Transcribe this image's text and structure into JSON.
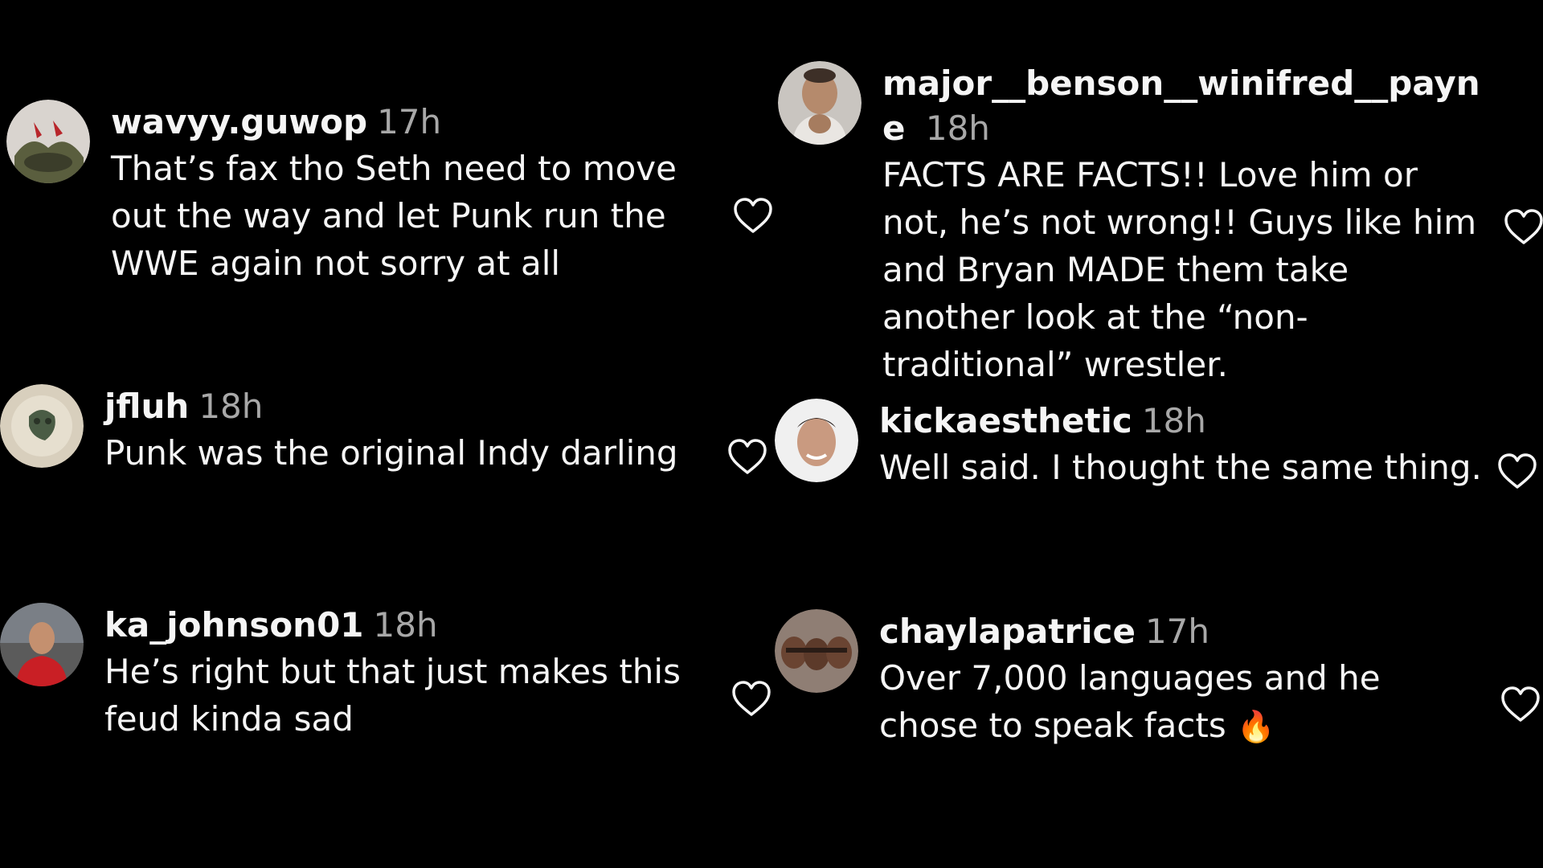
{
  "comments": [
    {
      "username": "wavyy.guwop",
      "time": "17h",
      "text": "That’s fax tho Seth need to move out the way and let Punk run the WWE again not sorry at all"
    },
    {
      "username": "major__benson__winifred__payne",
      "time": "18h",
      "text": "FACTS ARE FACTS!! Love him or not, he’s not wrong!! Guys like him and Bryan MADE them take another look at the “non-traditional” wrestler."
    },
    {
      "username": "jfluh",
      "time": "18h",
      "text": "Punk was the original Indy darling"
    },
    {
      "username": "kickaesthetic",
      "time": "18h",
      "text": "Well said. I thought the same thing."
    },
    {
      "username": "ka_johnson01",
      "time": "18h",
      "text": "He’s right but that just makes this feud kinda sad"
    },
    {
      "username": "chaylapatrice",
      "time": "17h",
      "text": "Over 7,000 languages and he chose to speak facts",
      "emoji": "🔥"
    }
  ],
  "icons": {
    "like": "heart-outline-icon",
    "avatar": "profile-photo"
  },
  "colors": {
    "background": "#000000",
    "text": "#f5f5f5",
    "timestamp": "#a8a8a8"
  }
}
